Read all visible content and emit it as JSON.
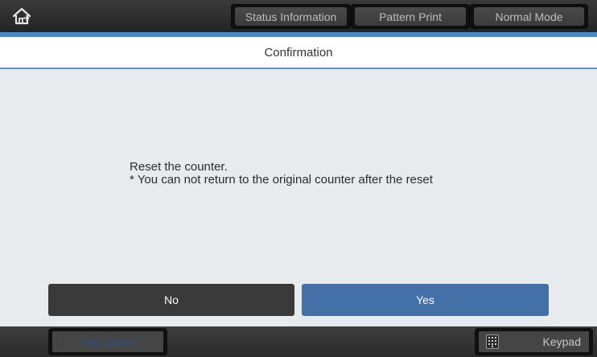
{
  "header": {
    "home_icon": "home-icon",
    "tabs": [
      {
        "label": "Status Information"
      },
      {
        "label": "Pattern Print"
      },
      {
        "label": "Normal Mode"
      }
    ]
  },
  "dialog": {
    "title": "Confirmation",
    "message_line1": "Reset the counter.",
    "message_line2": "* You can not return to the original counter after the reset",
    "no_label": "No",
    "yes_label": "Yes"
  },
  "footer": {
    "job_status_label": "Job Status",
    "keypad_label": "Keypad",
    "keypad_icon": "keypad-icon"
  },
  "colors": {
    "accent_blue": "#4f86c6",
    "yes_button": "#4470a8",
    "no_button": "#3a3a3a",
    "background": "#e7ebee"
  }
}
